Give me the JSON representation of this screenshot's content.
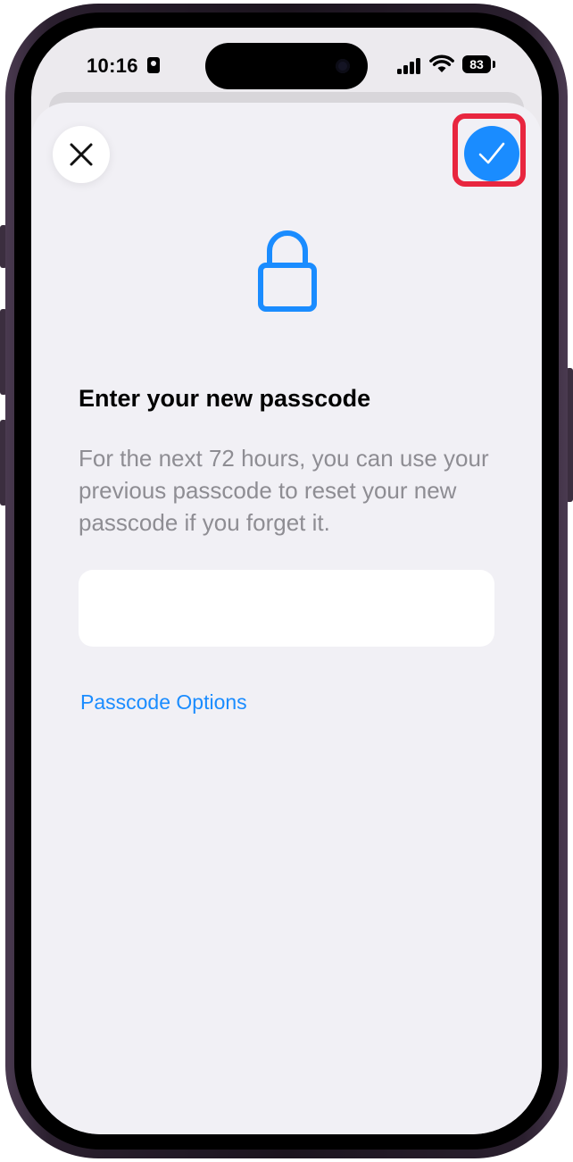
{
  "status_bar": {
    "time": "10:16",
    "battery_level": "83",
    "icons": [
      "id-card-icon",
      "signal-icon",
      "wifi-icon",
      "battery-icon"
    ]
  },
  "sheet": {
    "close_icon": "close-icon",
    "done_icon": "checkmark-icon",
    "lock_icon": "lock-icon",
    "heading": "Enter your new passcode",
    "description": "For the next 72 hours, you can use your previous passcode to reset your new passcode if you forget it.",
    "passcode_value": "",
    "passcode_options_label": "Passcode Options"
  },
  "colors": {
    "accent": "#1a8cff",
    "highlight": "#e8263f",
    "sheet_background": "#f1f0f5",
    "secondary_text": "#8e8d93"
  }
}
